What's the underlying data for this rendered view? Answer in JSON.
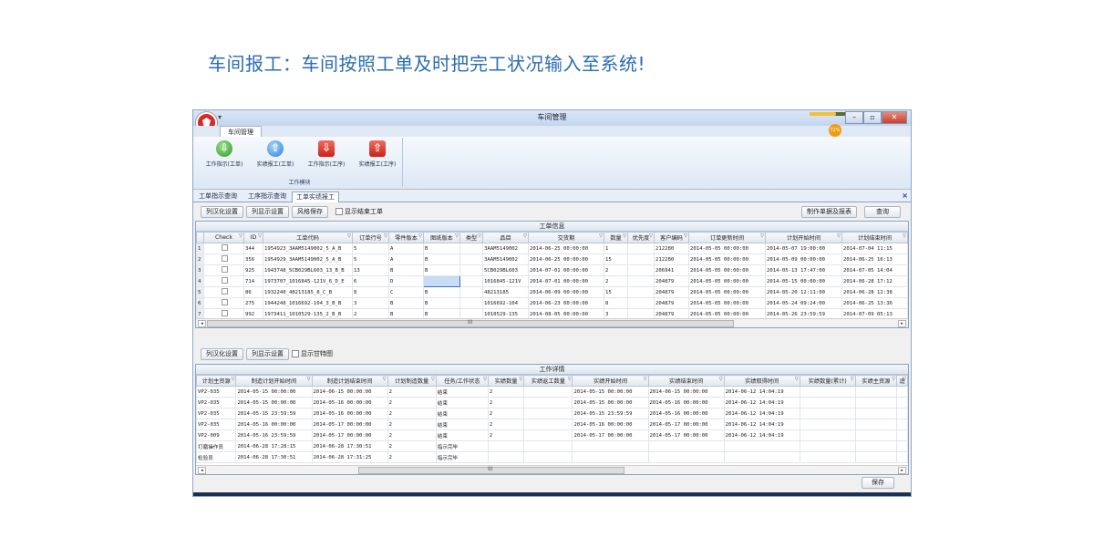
{
  "caption": "车间报工：车间按照工单及时把完工状况输入至系统!",
  "window": {
    "title": "车间管理",
    "quick_access": "▾",
    "battery_percent": 72,
    "battery_label": "72%",
    "min_glyph": "–",
    "max_glyph": "▫",
    "close_glyph": "✕"
  },
  "ribbon": {
    "tab": "车间管理",
    "group_label": "工作模块",
    "buttons": [
      {
        "label": "工作指示(工单)",
        "icon": "green-down-arrow-icon"
      },
      {
        "label": "实绩报工(工单)",
        "icon": "blue-up-arrow-icon"
      },
      {
        "label": "工作指示(工序)",
        "icon": "red-down-arrow-icon"
      },
      {
        "label": "实绩报工(工序)",
        "icon": "red-up-arrow-icon"
      }
    ]
  },
  "doc_tabs": [
    "工单指示查询",
    "工序指示查询",
    "工单实绩报工"
  ],
  "doc_close": "×",
  "top_toolbar": {
    "localize": "列汉化设置",
    "display": "列显示设置",
    "save_style": "风格保存",
    "show_finished": "显示结束工单",
    "make_report": "制作单据及报表",
    "query": "查询"
  },
  "work_info": {
    "caption": "工单信息",
    "columns": [
      "",
      "Check",
      "ID",
      "工单代码",
      "订单行号",
      "零件版本",
      "图纸版本",
      "类型",
      "品目",
      "交货期",
      "数量",
      "优先度",
      "客户编码",
      "订单更新时间",
      "计划开始时间",
      "计划结束时间"
    ],
    "rows": [
      [
        "1",
        "",
        "344",
        "1954923_3AAM5149002_5_A_B",
        "5",
        "A",
        "B",
        "",
        "3AAM5149002",
        "2014-06-25 00:00:00",
        "1",
        "",
        "212280",
        "2014-05-05 00:00:00",
        "2014-05-07 19:00:00",
        "2014-07-04 11:15"
      ],
      [
        "2",
        "",
        "356",
        "1954929_3AAM5149002_5_A_B",
        "5",
        "A",
        "B",
        "",
        "3AAM5149002",
        "2014-06-25 00:00:00",
        "15",
        "",
        "212280",
        "2014-05-05 00:00:00",
        "2014-05-09 00:00:00",
        "2014-06-25 16:13"
      ],
      [
        "3",
        "",
        "925",
        "1943748_5CB029BL603_13_B_B",
        "13",
        "B",
        "B",
        "",
        "5CB029BL603",
        "2014-07-01 00:00:00",
        "2",
        "",
        "206941",
        "2014-05-05 00:00:00",
        "2014-05-13 17:47:00",
        "2014-07-05 14:04"
      ],
      [
        "4",
        "",
        "714",
        "1973707_1016845-121V_6_D_E",
        "6",
        "D",
        "",
        "",
        "1016845-121V",
        "2014-07-01 00:00:00",
        "2",
        "",
        "204879",
        "2014-05-05 00:00:00",
        "2014-05-15 00:00:00",
        "2014-06-28 17:12"
      ],
      [
        "5",
        "",
        "86",
        "1932240_48213185_8_C_B",
        "8",
        "C",
        "B",
        "",
        "48213185",
        "2014-06-09 00:00:00",
        "15",
        "",
        "204879",
        "2014-05-05 00:00:00",
        "2014-05-20 12:11:00",
        "2014-06-28 12:38"
      ],
      [
        "6",
        "",
        "275",
        "1944248_1016692-104_3_B_B",
        "3",
        "B",
        "B",
        "",
        "1016692-104",
        "2014-06-23 00:00:00",
        "8",
        "",
        "204879",
        "2014-05-05 00:00:00",
        "2014-05-24 09:24:00",
        "2014-06-25 13:36"
      ],
      [
        "7",
        "",
        "992",
        "1973411_1010529-135_2_B_B",
        "2",
        "B",
        "B",
        "",
        "1010529-135",
        "2014-08-05 00:00:00",
        "3",
        "",
        "204879",
        "2014-05-05 00:00:00",
        "2014-05-26 23:59:59",
        "2014-07-09 05:13"
      ]
    ],
    "scroll_mid": "III"
  },
  "bottom_toolbar": {
    "localize": "列汉化设置",
    "display": "列显示设置",
    "show_gantt": "显示甘特图"
  },
  "work_detail": {
    "caption": "工作详情",
    "columns": [
      "计划主资源",
      "制造计划开始时间",
      "制造计划结束时间",
      "计划制造数量",
      "任务/工作状态",
      "实绩数量",
      "实绩返工数量",
      "实绩开始时间",
      "实绩结束时间",
      "实绩取得时间",
      "实绩数量(累计)",
      "实绩主资源",
      "追"
    ],
    "rows": [
      [
        "VP2-035",
        "2014-05-15 00:00:00",
        "2014-06-15 00:00:00",
        "2",
        "结束",
        "2",
        "",
        "2014-05-15 00:00:00",
        "2014-06-15 00:00:00",
        "2014-06-12 14:04:19",
        "",
        "",
        ""
      ],
      [
        "VP2-035",
        "2014-05-15 00:00:00",
        "2014-05-16 00:00:00",
        "2",
        "结束",
        "2",
        "",
        "2014-05-15 00:00:00",
        "2014-05-16 00:00:00",
        "2014-06-12 14:04:19",
        "",
        "",
        ""
      ],
      [
        "VP2-035",
        "2014-05-15 23:59:59",
        "2014-05-16 00:00:00",
        "2",
        "结束",
        "2",
        "",
        "2014-05-15 23:59:59",
        "2014-05-16 00:00:00",
        "2014-06-12 14:04:19",
        "",
        "",
        ""
      ],
      [
        "VP2-035",
        "2014-05-16 00:00:00",
        "2014-05-17 00:00:00",
        "2",
        "结束",
        "2",
        "",
        "2014-05-16 00:00:00",
        "2014-05-17 00:00:00",
        "2014-06-12 14:04:19",
        "",
        "",
        ""
      ],
      [
        "VP2-009",
        "2014-05-16 23:59:59",
        "2014-05-17 00:00:00",
        "2",
        "结束",
        "2",
        "",
        "2014-05-17 00:00:00",
        "2014-05-17 00:00:00",
        "2014-06-12 14:04:19",
        "",
        "",
        ""
      ],
      [
        "打磨操作员",
        "2014-06-28 17:28:15",
        "2014-06-28 17:30:51",
        "2",
        "指示完毕",
        "",
        "",
        "",
        "",
        "",
        "",
        "",
        ""
      ],
      [
        "检验员",
        "2014-06-28 17:30:51",
        "2014-06-28 17:31:25",
        "2",
        "指示完毕",
        "",
        "",
        "",
        "",
        "",
        "",
        "",
        ""
      ]
    ],
    "scroll_mid": "III"
  },
  "save_button": "保存"
}
